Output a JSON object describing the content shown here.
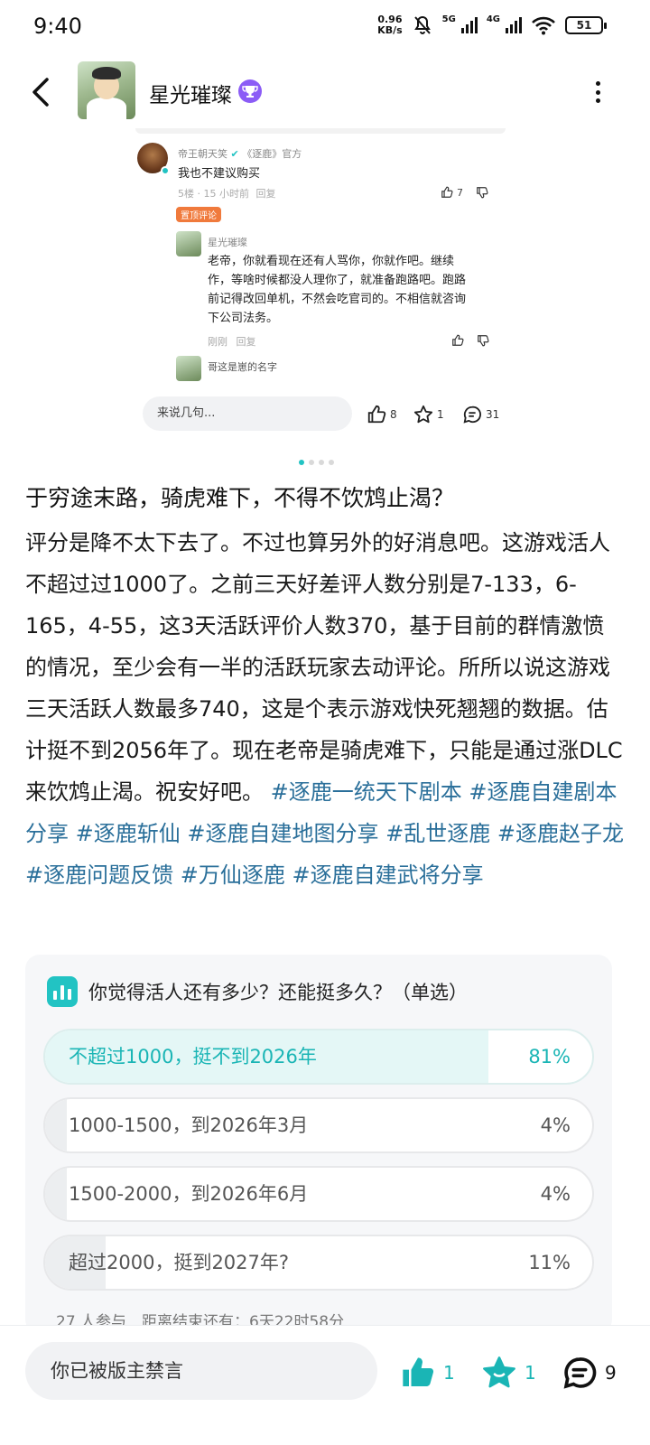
{
  "status_bar": {
    "time": "9:40",
    "net_speed_value": "0.96",
    "net_speed_unit": "KB/s",
    "net1": "5G",
    "net2": "4G",
    "battery": "51",
    "icons": [
      "mute-icon",
      "signal-icon",
      "wifi-icon",
      "battery-icon"
    ]
  },
  "header": {
    "username": "星光璀璨",
    "back_icon": "back-arrow-icon",
    "more_icon": "more-vertical-icon"
  },
  "embedded_screenshot": {
    "comment": {
      "name": "帝王朝天笑",
      "tags": "《逐鹿》官方",
      "text": "我也不建议购买",
      "meta": "5楼 · 15 小时前",
      "reply_label": "回复",
      "likes": "7",
      "pin_label": "置顶评论"
    },
    "reply": {
      "name": "星光璀璨",
      "text_lines": [
        "老帝，你就看现在还有人骂你，你就作吧。继续",
        "作，等啥时候都没人理你了，就准备跑路吧。跑路",
        "前记得改回单机，不然会吃官司的。不相信就咨询",
        "下公司法务。"
      ],
      "meta": "刚刚",
      "reply_label": "回复"
    },
    "reply2": {
      "text": "哥这是崽的名字"
    },
    "input_placeholder": "来说几句...",
    "likes": "8",
    "favorites": "1",
    "comments": "31"
  },
  "carousel": {
    "count": 4,
    "active": 0
  },
  "post": {
    "title": "于穷途末路，骑虎难下，不得不饮鸩止渴？",
    "body": "评分是降不太下去了。不过也算另外的好消息吧。这游戏活人不超过过1000了。之前三天好差评人数分别是7-133，6-165，4-55，这3天活跃评价人数370，基于目前的群情激愤的情况，至少会有一半的活跃玩家去动评论。所所以说这游戏三天活跃人数最多740，这是个表示游戏快死翘翘的数据。估计挺不到2056年了。现在老帝是骑虎难下，只能是通过涨DLC来饮鸩止渴。祝安好吧。",
    "tags": [
      "#逐鹿一统天下剧本",
      "#逐鹿自建剧本分享",
      "#逐鹿斩仙",
      "#逐鹿自建地图分享",
      "#乱世逐鹿",
      "#逐鹿赵子龙",
      "#逐鹿问题反馈",
      "#万仙逐鹿",
      "#逐鹿自建武将分享"
    ]
  },
  "poll": {
    "question": "你觉得活人还有多少？还能挺多久？（单选）",
    "options": [
      {
        "label": "不超过1000，挺不到2026年",
        "percent": "81%",
        "fraction": 0.81,
        "selected": true
      },
      {
        "label": "1000-1500，到2026年3月",
        "percent": "4%",
        "fraction": 0.04,
        "selected": false
      },
      {
        "label": "1500-2000，到2026年6月",
        "percent": "4%",
        "fraction": 0.04,
        "selected": false
      },
      {
        "label": "超过2000，挺到2027年?",
        "percent": "11%",
        "fraction": 0.11,
        "selected": false
      }
    ],
    "footer": "27 人参与　距离结束还有：6天22时58分"
  },
  "bottom_bar": {
    "input_text": "你已被版主禁言",
    "likes": "1",
    "favorites": "1",
    "comments": "9",
    "accent": "#1ab5b5"
  }
}
